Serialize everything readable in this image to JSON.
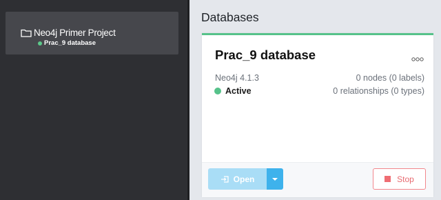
{
  "sidebar": {
    "project": {
      "name": "Neo4j Primer Project",
      "database": "Prac_9 database",
      "icon": "folder-icon",
      "status_color": "#5cc98a"
    }
  },
  "main": {
    "title": "Databases",
    "card": {
      "title": "Prac_9 database",
      "more_icon": "more-horizontal-icon",
      "version": "Neo4j 4.1.3",
      "nodes": "0 nodes (0 labels)",
      "status": "Active",
      "status_color": "#56c28a",
      "relationships": "0 relationships (0 types)",
      "open_label": "Open",
      "open_icon": "open-arrow-icon",
      "stop_label": "Stop",
      "stop_icon": "stop-icon",
      "accent_color": "#3eb2ec",
      "stop_color": "#ef6d73"
    }
  }
}
